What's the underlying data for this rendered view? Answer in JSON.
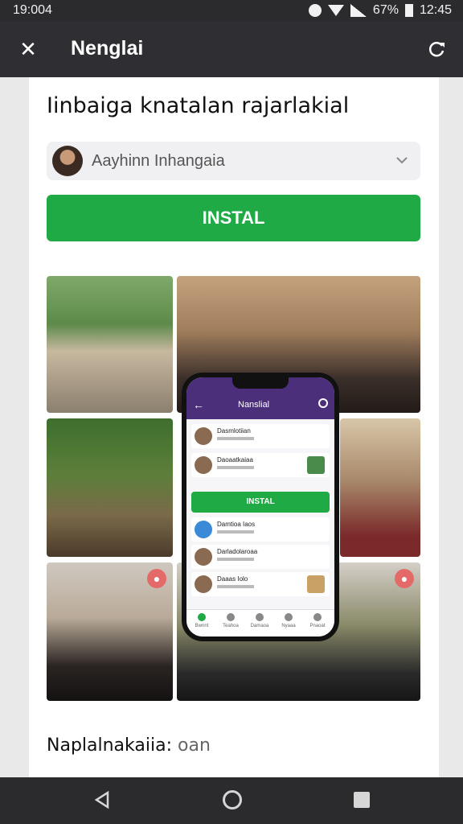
{
  "status_bar": {
    "time_left": "19:004",
    "battery": "67%",
    "time_right": "12:45",
    "icons": [
      "alarm-icon",
      "wifi-icon",
      "signal-icon",
      "battery-icon"
    ]
  },
  "app_bar": {
    "title": "Nenglai",
    "close_icon": "close-icon",
    "refresh_icon": "refresh-icon"
  },
  "content": {
    "heading": "Iinbaiga knatalan rajarlakial",
    "account": {
      "name": "Aayhinn Inhangaia",
      "chevron_icon": "chevron-down-icon"
    },
    "install_label": "INSTAL",
    "footer_label": "Naplalnakaiia:",
    "footer_value": "oan"
  },
  "phone_mockup": {
    "title": "Nanslial",
    "rows_top": [
      {
        "text": "Dasmlotiian"
      },
      {
        "text": "Daoaatkaiaa"
      }
    ],
    "install_label": "INSTAL",
    "rows_bottom": [
      {
        "text": "Damtioa Iaos"
      },
      {
        "text": "Darladolaroaa"
      },
      {
        "text": "Daaas Iolo"
      }
    ],
    "tabs": [
      "Bwnnt",
      "Teahoa",
      "Damaoa",
      "Nyaaa",
      "Pnaoat"
    ]
  },
  "colors": {
    "accent_green": "#1faa45",
    "app_bar": "#2f2f33",
    "phone_header": "#4b2f7a"
  },
  "nav_bar": {
    "icons": [
      "back-icon",
      "home-icon",
      "recents-icon"
    ]
  }
}
